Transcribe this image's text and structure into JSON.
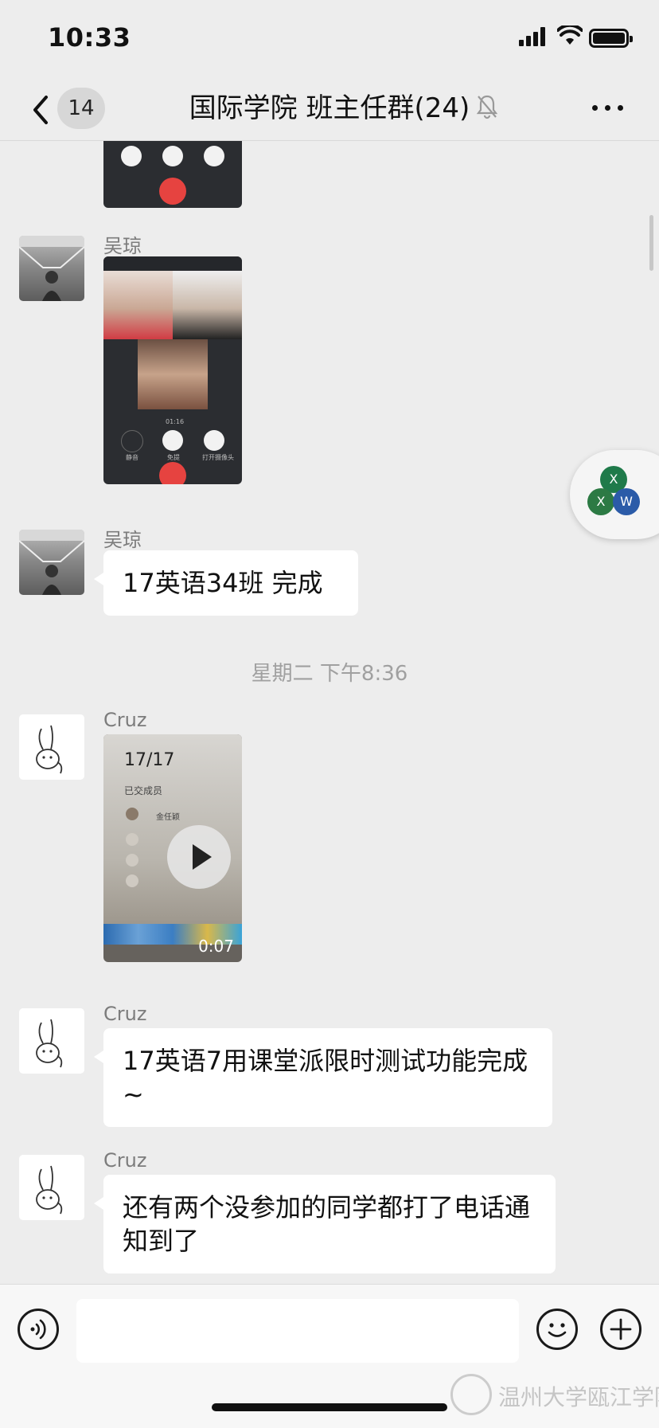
{
  "status_bar": {
    "time": "10:33"
  },
  "nav": {
    "unread_count": "14",
    "title": "国际学院  班主任群(24)"
  },
  "messages": [
    {
      "type": "image",
      "sender": ""
    },
    {
      "type": "image",
      "sender": "吴琼",
      "call_timer": "01:16",
      "call_controls": [
        "静音",
        "免提",
        "打开摄像头"
      ]
    },
    {
      "type": "text",
      "sender": "吴琼",
      "text": "17英语34班 完成"
    },
    {
      "type": "time",
      "text": "星期二 下午8:36"
    },
    {
      "type": "video",
      "sender": "Cruz",
      "duration": "0:07",
      "screen_count": "17/17",
      "screen_label": "已交成员",
      "screen_name": "金任颖"
    },
    {
      "type": "text",
      "sender": "Cruz",
      "text": "17英语7用课堂派限时测试功能完成~"
    },
    {
      "type": "text",
      "sender": "Cruz",
      "text": "还有两个没参加的同学都打了电话通知到了"
    }
  ],
  "float_widget": {
    "letters": [
      "X",
      "X",
      "W"
    ]
  },
  "input": {
    "placeholder": ""
  },
  "watermark": {
    "text": "温州大学瓯江学院"
  },
  "colors": {
    "background": "#ededed",
    "bubble": "#ffffff",
    "hangup": "#e64340"
  }
}
